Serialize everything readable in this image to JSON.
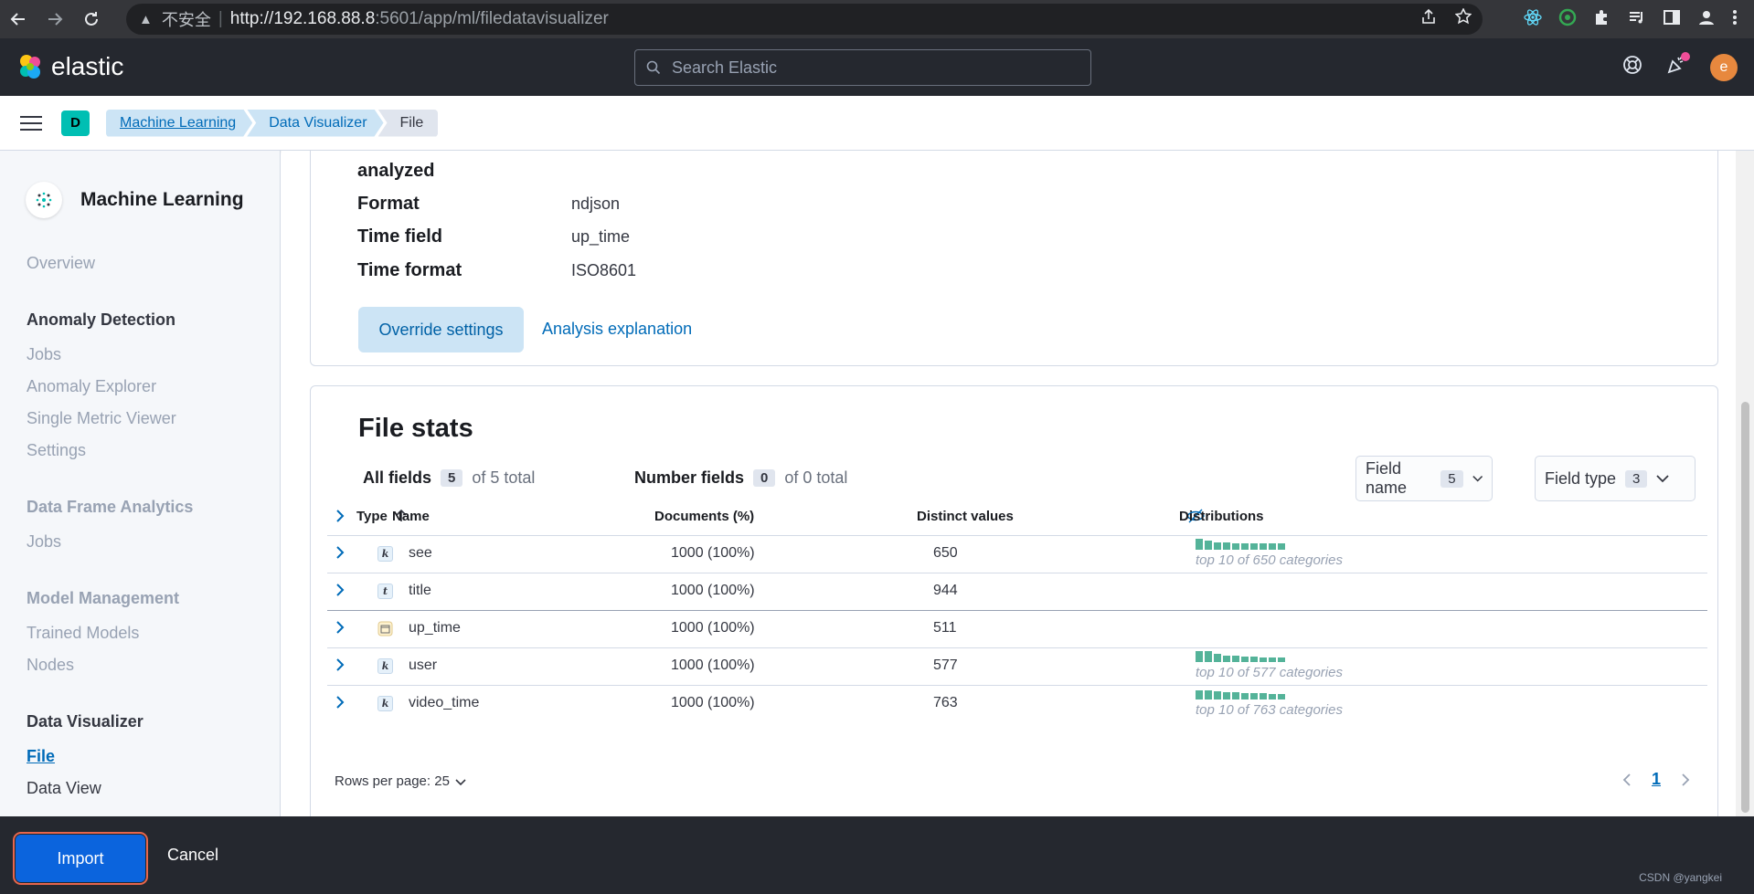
{
  "browser": {
    "security_label": "不安全",
    "url_host": "http://192.168.88.8",
    "url_path": ":5601/app/ml/filedatavisualizer"
  },
  "header": {
    "brand": "elastic",
    "search_placeholder": "Search Elastic",
    "avatar_initial": "e"
  },
  "crumbbar": {
    "space_initial": "D",
    "breadcrumbs": [
      "Machine Learning",
      "Data Visualizer",
      "File"
    ]
  },
  "sidebar": {
    "title": "Machine Learning",
    "overview": "Overview",
    "anomaly_detection": {
      "heading": "Anomaly Detection",
      "items": [
        "Jobs",
        "Anomaly Explorer",
        "Single Metric Viewer",
        "Settings"
      ]
    },
    "dfa": {
      "heading": "Data Frame Analytics",
      "items": [
        "Jobs"
      ]
    },
    "model_mgmt": {
      "heading": "Model Management",
      "items": [
        "Trained Models",
        "Nodes"
      ]
    },
    "data_visualizer": {
      "heading": "Data Visualizer",
      "items": [
        "File",
        "Data View"
      ]
    }
  },
  "summary": {
    "analyzed_label": "analyzed",
    "rows": [
      {
        "key": "Format",
        "value": "ndjson"
      },
      {
        "key": "Time field",
        "value": "up_time"
      },
      {
        "key": "Time format",
        "value": "ISO8601"
      }
    ],
    "override_button": "Override settings",
    "analysis_link": "Analysis explanation"
  },
  "file_stats": {
    "title": "File stats",
    "all_fields": {
      "label": "All fields",
      "count": "5",
      "of": "of 5 total"
    },
    "number_fields": {
      "label": "Number fields",
      "count": "0",
      "of": "of 0 total"
    },
    "field_name_filter": {
      "label": "Field name",
      "count": "5"
    },
    "field_type_filter": {
      "label": "Field type",
      "count": "3"
    },
    "columns": {
      "type": "Type",
      "name": "Name",
      "documents": "Documents (%)",
      "distinct": "Distinct values",
      "distributions": "Distributions"
    },
    "rows": [
      {
        "type": "k",
        "name": "see",
        "docs": "1000 (100%)",
        "distinct": "650",
        "dist_caption": "top 10 of 650 categories"
      },
      {
        "type": "t",
        "name": "title",
        "docs": "1000 (100%)",
        "distinct": "944",
        "dist_caption": ""
      },
      {
        "type": "date",
        "name": "up_time",
        "docs": "1000 (100%)",
        "distinct": "511",
        "dist_caption": ""
      },
      {
        "type": "k",
        "name": "user",
        "docs": "1000 (100%)",
        "distinct": "577",
        "dist_caption": "top 10 of 577 categories"
      },
      {
        "type": "k",
        "name": "video_time",
        "docs": "1000 (100%)",
        "distinct": "763",
        "dist_caption": "top 10 of 763 categories"
      }
    ],
    "rows_per_page": "Rows per page: 25",
    "current_page": "1"
  },
  "footer": {
    "import_button": "Import",
    "cancel_button": "Cancel",
    "watermark": "CSDN @yangkei"
  },
  "colors": {
    "accent": "#006bb8",
    "primary_button": "#0b64dd",
    "bar": "#54b399",
    "header_bg": "#25282f"
  }
}
